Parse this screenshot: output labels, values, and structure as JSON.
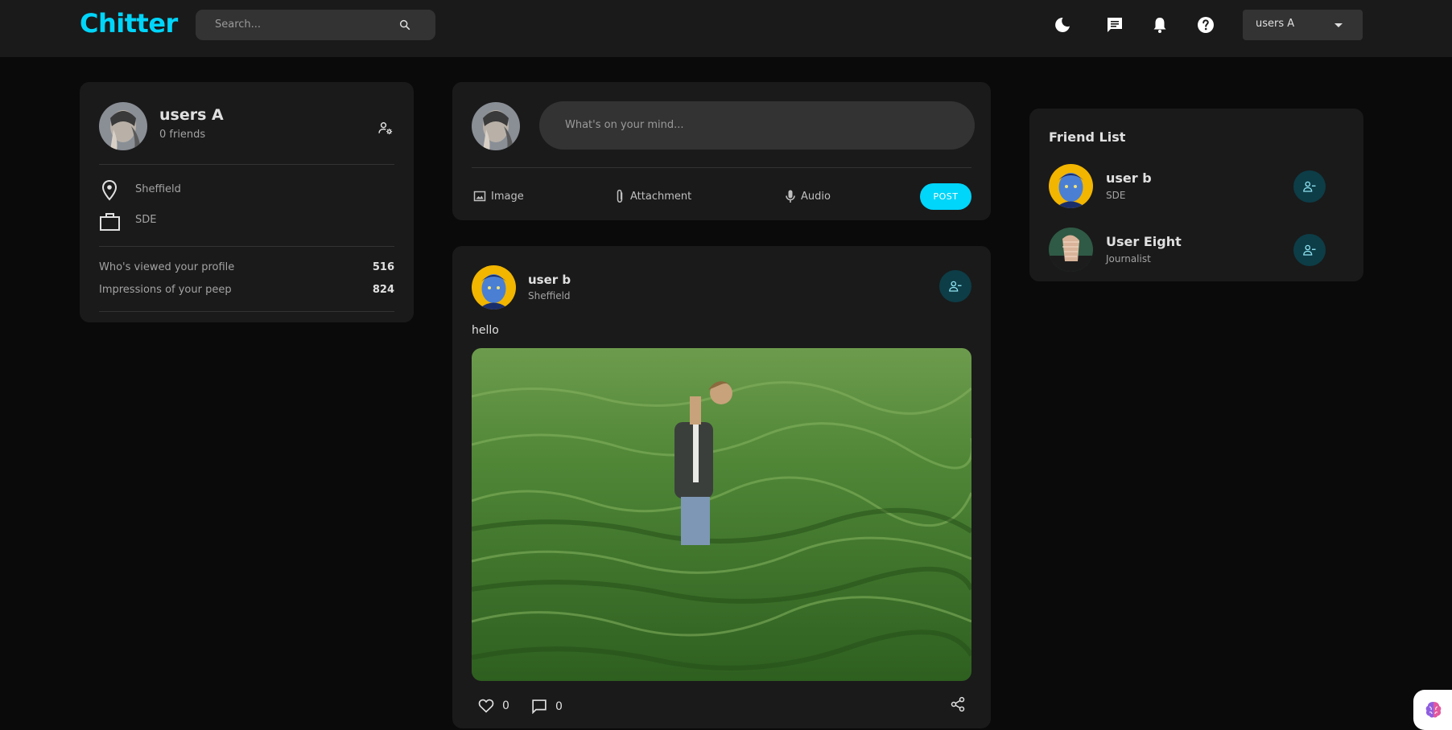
{
  "app": {
    "logo": "Chitter"
  },
  "navbar": {
    "search_placeholder": "Search...",
    "user_select": "users A"
  },
  "profile": {
    "name": "users A",
    "friends": "0 friends",
    "location": "Sheffield",
    "occupation": "SDE",
    "stats": [
      {
        "label": "Who's viewed your profile",
        "value": "516"
      },
      {
        "label": "Impressions of your peep",
        "value": "824"
      }
    ]
  },
  "composer": {
    "placeholder": "What's on your mind...",
    "actions": {
      "image": "Image",
      "attachment": "Attachment",
      "audio": "Audio"
    },
    "post_label": "POST"
  },
  "post": {
    "author": "user b",
    "location": "Sheffield",
    "text": "hello",
    "likes": "0",
    "comments": "0"
  },
  "friend_list": {
    "title": "Friend List",
    "friends": [
      {
        "name": "user b",
        "subtitle": "SDE"
      },
      {
        "name": "User Eight",
        "subtitle": "Journalist"
      }
    ]
  },
  "colors": {
    "accent": "#00d5fa",
    "background": "#0a0a0a",
    "card": "#1a1a1a",
    "input": "#333333",
    "friend_button": "#0d3d47"
  }
}
